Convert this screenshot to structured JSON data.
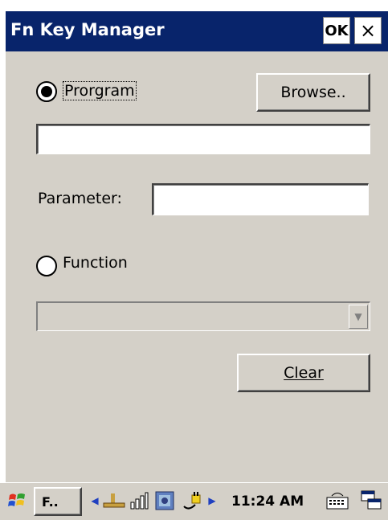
{
  "window": {
    "title": "Fn Key Manager",
    "ok_label": "OK",
    "close_label": "×"
  },
  "program": {
    "radio_label": "Prorgram",
    "selected": true,
    "browse_label": "Browse..",
    "path_value": ""
  },
  "parameter": {
    "label": "Parameter:",
    "value": ""
  },
  "function": {
    "radio_label": "Function",
    "selected": false,
    "dropdown_value": ""
  },
  "clear_label": "Clear",
  "taskbar": {
    "task_label": "F..",
    "clock": "11:24 AM",
    "icons": [
      "windows-start-icon",
      "network-icon",
      "signal-icon",
      "app-icon",
      "power-plug-icon",
      "keyboard-icon",
      "switch-window-icon"
    ]
  },
  "colors": {
    "titlebar": "#08246b",
    "background": "#d4d0c8"
  }
}
